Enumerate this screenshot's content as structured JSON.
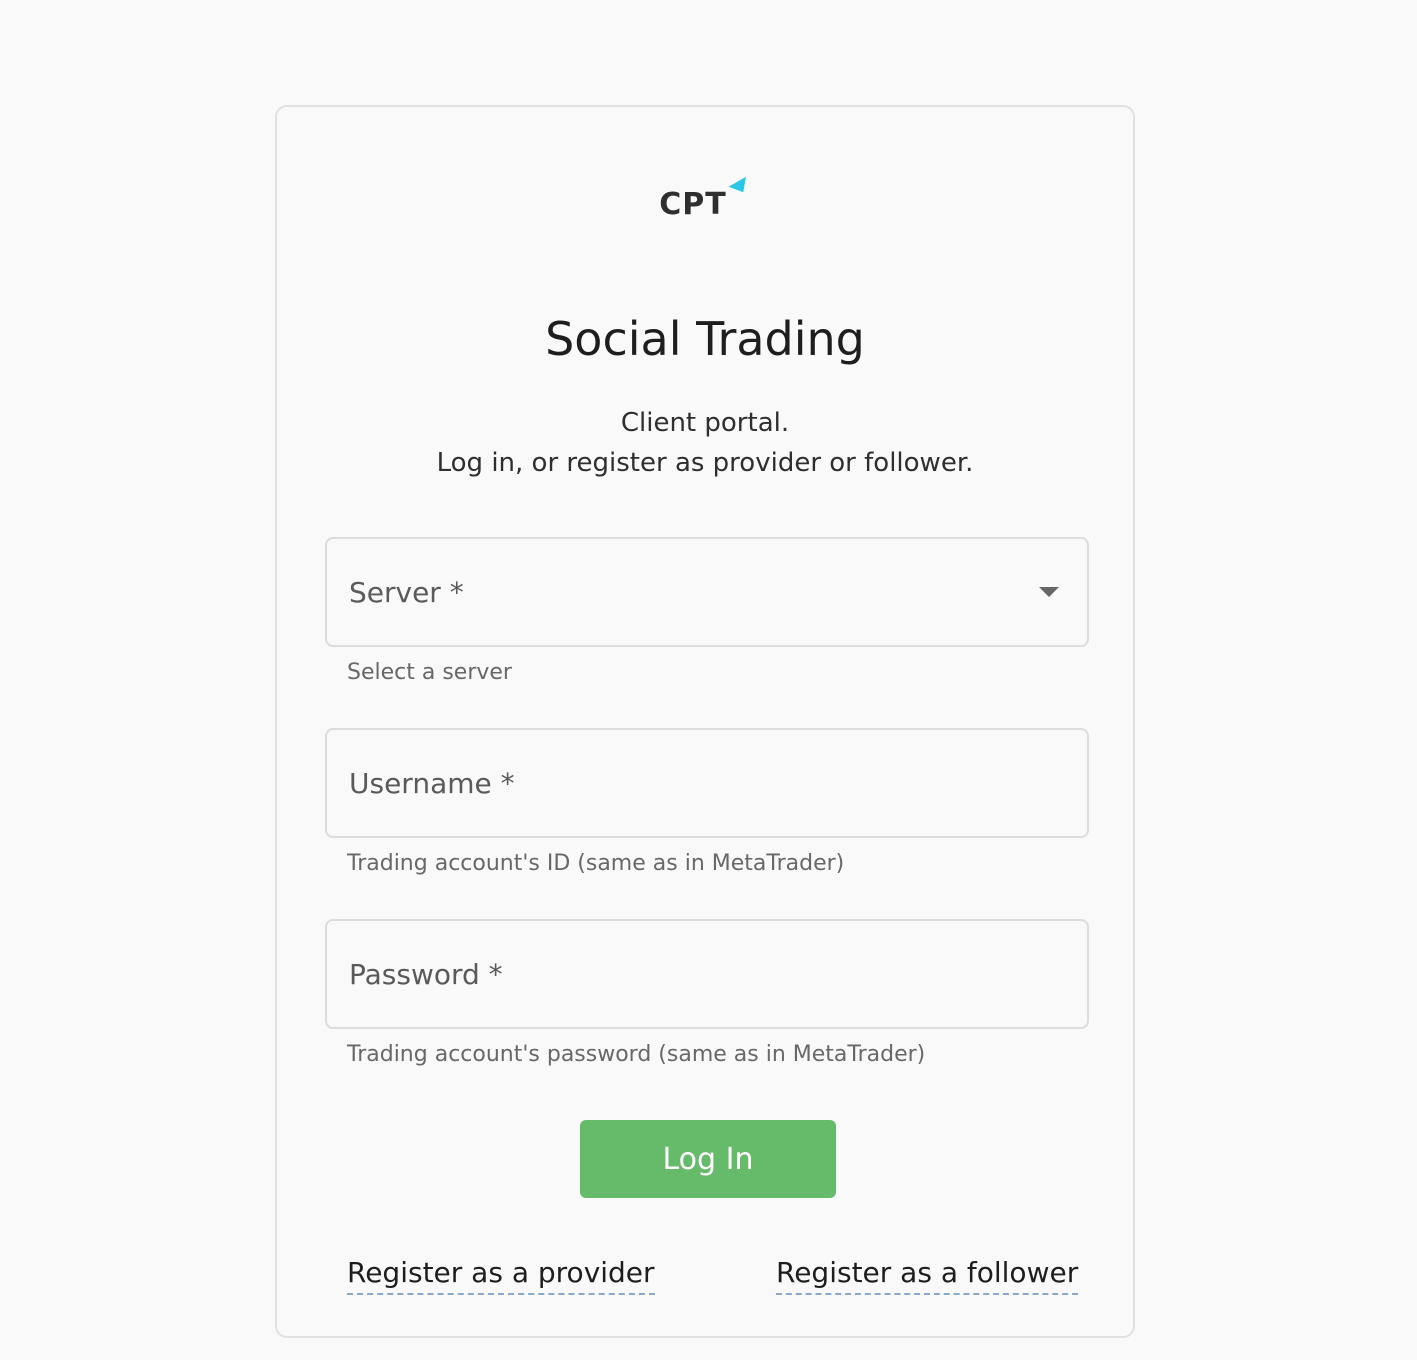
{
  "brand": {
    "logo_text": "CPT",
    "logo_mark_icon": "triangle-icon",
    "accent_color": "#2ac7e7"
  },
  "header": {
    "title": "Social Trading",
    "subtitle_line1": "Client portal.",
    "subtitle_line2": "Log in, or register as provider or follower."
  },
  "form": {
    "server": {
      "label": "Server *",
      "hint": "Select a server",
      "icon": "chevron-down-icon"
    },
    "username": {
      "label": "Username *",
      "hint": "Trading account's ID (same as in MetaTrader)"
    },
    "password": {
      "label": "Password *",
      "hint": "Trading account's password (same as in MetaTrader)"
    },
    "submit_label": "Log In",
    "submit_color": "#66bb6a"
  },
  "links": {
    "register_provider": "Register as a provider",
    "register_follower": "Register as a follower"
  }
}
